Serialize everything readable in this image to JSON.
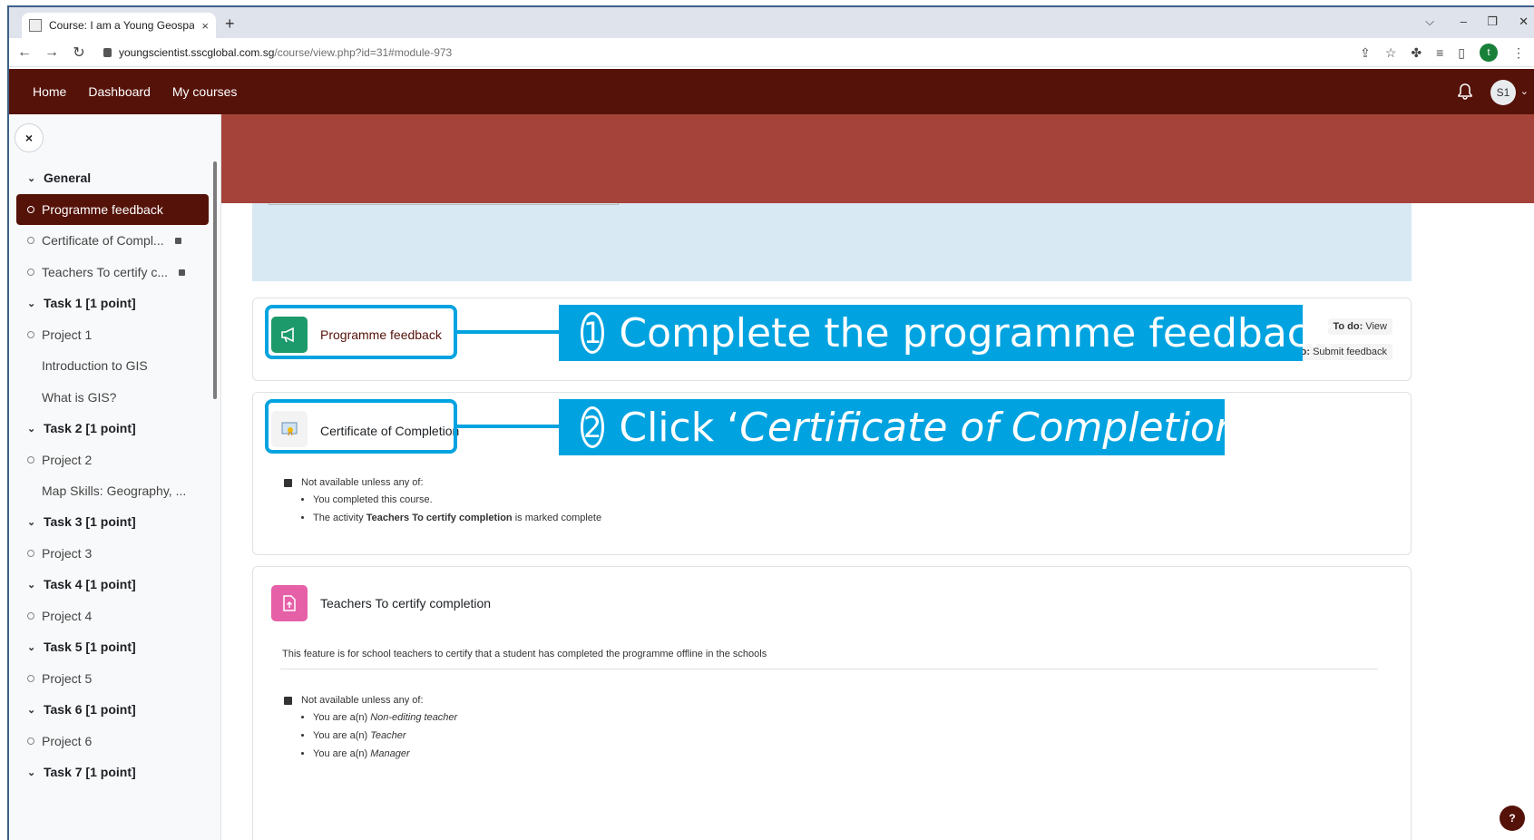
{
  "browser": {
    "tab_title": "Course: I am a Young Geospatial",
    "tab_close": "×",
    "new_tab": "+",
    "url_host": "youngscientist.sscglobal.com.sg",
    "url_path": "/course/view.php?id=31#module-973",
    "profile_initial": "t",
    "window_controls": [
      "⌵",
      "–",
      "❐",
      "✕"
    ]
  },
  "navbar": {
    "links": [
      "Home",
      "Dashboard",
      "My courses"
    ],
    "avatar_initials": "S1"
  },
  "sidebar": {
    "close_label": "×",
    "items": [
      {
        "label": "General",
        "type": "section"
      },
      {
        "label": "Programme feedback",
        "type": "activity",
        "active": true
      },
      {
        "label": "Certificate of Compl...",
        "type": "activity",
        "locked": true
      },
      {
        "label": "Teachers To certify c...",
        "type": "activity",
        "locked": true
      },
      {
        "label": "Task 1 [1 point]",
        "type": "section"
      },
      {
        "label": "Project 1",
        "type": "activity"
      },
      {
        "label": "Introduction to GIS",
        "type": "page"
      },
      {
        "label": "What is GIS?",
        "type": "page"
      },
      {
        "label": "Task 2 [1 point]",
        "type": "section"
      },
      {
        "label": "Project 2",
        "type": "activity"
      },
      {
        "label": "Map Skills: Geography, ...",
        "type": "page"
      },
      {
        "label": "Task 3 [1 point]",
        "type": "section"
      },
      {
        "label": "Project 3",
        "type": "activity"
      },
      {
        "label": "Task 4 [1 point]",
        "type": "section"
      },
      {
        "label": "Project 4",
        "type": "activity"
      },
      {
        "label": "Task 5 [1 point]",
        "type": "section"
      },
      {
        "label": "Project 5",
        "type": "activity"
      },
      {
        "label": "Task 6 [1 point]",
        "type": "section"
      },
      {
        "label": "Project 6",
        "type": "activity"
      },
      {
        "label": "Task 7 [1 point]",
        "type": "section"
      }
    ]
  },
  "activities": {
    "feedback": {
      "name": "Programme feedback",
      "todo_1_label": "To do:",
      "todo_1_value": "View",
      "todo_2_label": "o:",
      "todo_2_value": "Submit feedback"
    },
    "certificate": {
      "name": "Certificate of Completion",
      "restriction_head": "Not available unless any of:",
      "conditions": [
        {
          "pre": "You completed this course.",
          "bold": "",
          "post": ""
        },
        {
          "pre": "The activity ",
          "bold": "Teachers To certify completion",
          "post": " is marked complete"
        }
      ]
    },
    "teachers": {
      "name": "Teachers To certify completion",
      "description": "This feature is for school teachers to certify that a student has completed the programme offline in the schools",
      "restriction_head": "Not available unless any of:",
      "conditions": [
        {
          "pre": "You are a(n) ",
          "italic": "Non-editing teacher"
        },
        {
          "pre": "You are a(n) ",
          "italic": "Teacher"
        },
        {
          "pre": "You are a(n) ",
          "italic": "Manager"
        }
      ]
    }
  },
  "annotations": {
    "step1_num": "1",
    "step1_text": "Complete the programme feedback",
    "step2_num": "2",
    "step2_prefix": "Click ‘",
    "step2_italic": "Certificate of Completion",
    "step2_suffix": "’",
    "color": "#00a3e0"
  },
  "help_label": "?",
  "colors": {
    "navbar": "#551209",
    "banner": "#a5433b",
    "info_box": "#d8e9f4",
    "feedback_icon": "#1c9a6c",
    "certify_icon": "#e660a8"
  }
}
